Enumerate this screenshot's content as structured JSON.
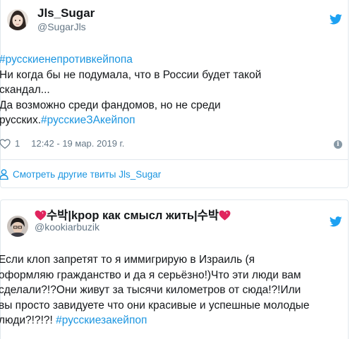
{
  "tweet1": {
    "name": "Jls_Sugar",
    "handle": "@SugarJls",
    "text_lines": [
      {
        "tag": "#русскиенепротивкейпопа",
        "text": ""
      },
      {
        "tag": "",
        "text": "Ни когда бы не подумала, что в России будет такой"
      },
      {
        "tag": "",
        "text": "скандал..."
      },
      {
        "tag": "",
        "text": "Да возможно среди фандомов, но не среди"
      }
    ],
    "last_line_text": "русских.",
    "last_line_tag": "#русскиеЗАкейпоп",
    "likes": "1",
    "timestamp": "12:42 - 19 мар. 2019 г.",
    "more_link": "Смотреть другие твиты Jls_Sugar",
    "info_symbol": "i"
  },
  "tweet2": {
    "name_korean_left": "수박",
    "name_middle": "|kpop как смысл жить|",
    "name_korean_right": "수박",
    "handle": "@kookiarbuzik",
    "text_lines": [
      "Если клоп запретят то я иммигрирую в Израиль (я",
      "оформляю гражданство и да я серьёзно!)Что эти люди вам",
      "сделали?!?Они живут за тысячи километров от сюда!?!Или",
      "вы просто завидуете что они красивые и успешные молодые"
    ],
    "last_line_text": "люди?!?!?! ",
    "last_line_tag": "#русскиезакейпоп"
  },
  "colors": {
    "link": "#1b95e0",
    "text": "#14171a",
    "muted": "#657786",
    "heart_emoji": "#e0245e",
    "twitter_bird": "#1da1f2"
  },
  "icons": [
    "twitter-bird-icon",
    "heart-outline-icon",
    "info-icon",
    "person-icon",
    "heart-emoji-icon"
  ]
}
